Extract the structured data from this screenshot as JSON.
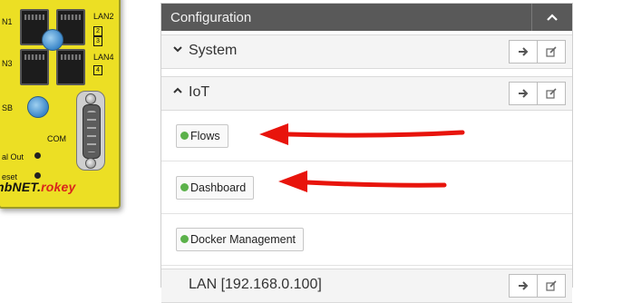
{
  "device": {
    "labels": {
      "lan1": "N1",
      "lan2": "LAN2",
      "lan3": "N3",
      "lan4": "LAN4",
      "usb": "SB",
      "com": "COM",
      "digital_out": "al Out",
      "reset": "eset"
    },
    "port_numbers": [
      "2",
      "3",
      "4"
    ],
    "brand_prefix": "nbNET.",
    "brand_suffix": "rokey",
    "colors": {
      "body": "#ecdf24",
      "brand_accent": "#d9261c"
    }
  },
  "panel": {
    "title": "Configuration",
    "collapse_icon": "chevron-up-icon",
    "sections": [
      {
        "title": "System",
        "chevron": "chevron-down-icon",
        "expanded": false
      },
      {
        "title": "IoT",
        "chevron": "chevron-up-icon",
        "expanded": true
      }
    ],
    "section_actions": {
      "go": "arrow-right-icon",
      "edit": "edit-icon"
    },
    "iot_items": [
      {
        "label": "Flows",
        "status_color": "#5bb14a"
      },
      {
        "label": "Dashboard",
        "status_color": "#5bb14a"
      },
      {
        "label": "Docker Management",
        "status_color": "#5bb14a"
      }
    ],
    "partial_section_title": "LAN [192.168.0.100]"
  },
  "annotations": {
    "arrow_color": "#e8140c",
    "arrow_targets": [
      "Flows",
      "Dashboard"
    ]
  }
}
